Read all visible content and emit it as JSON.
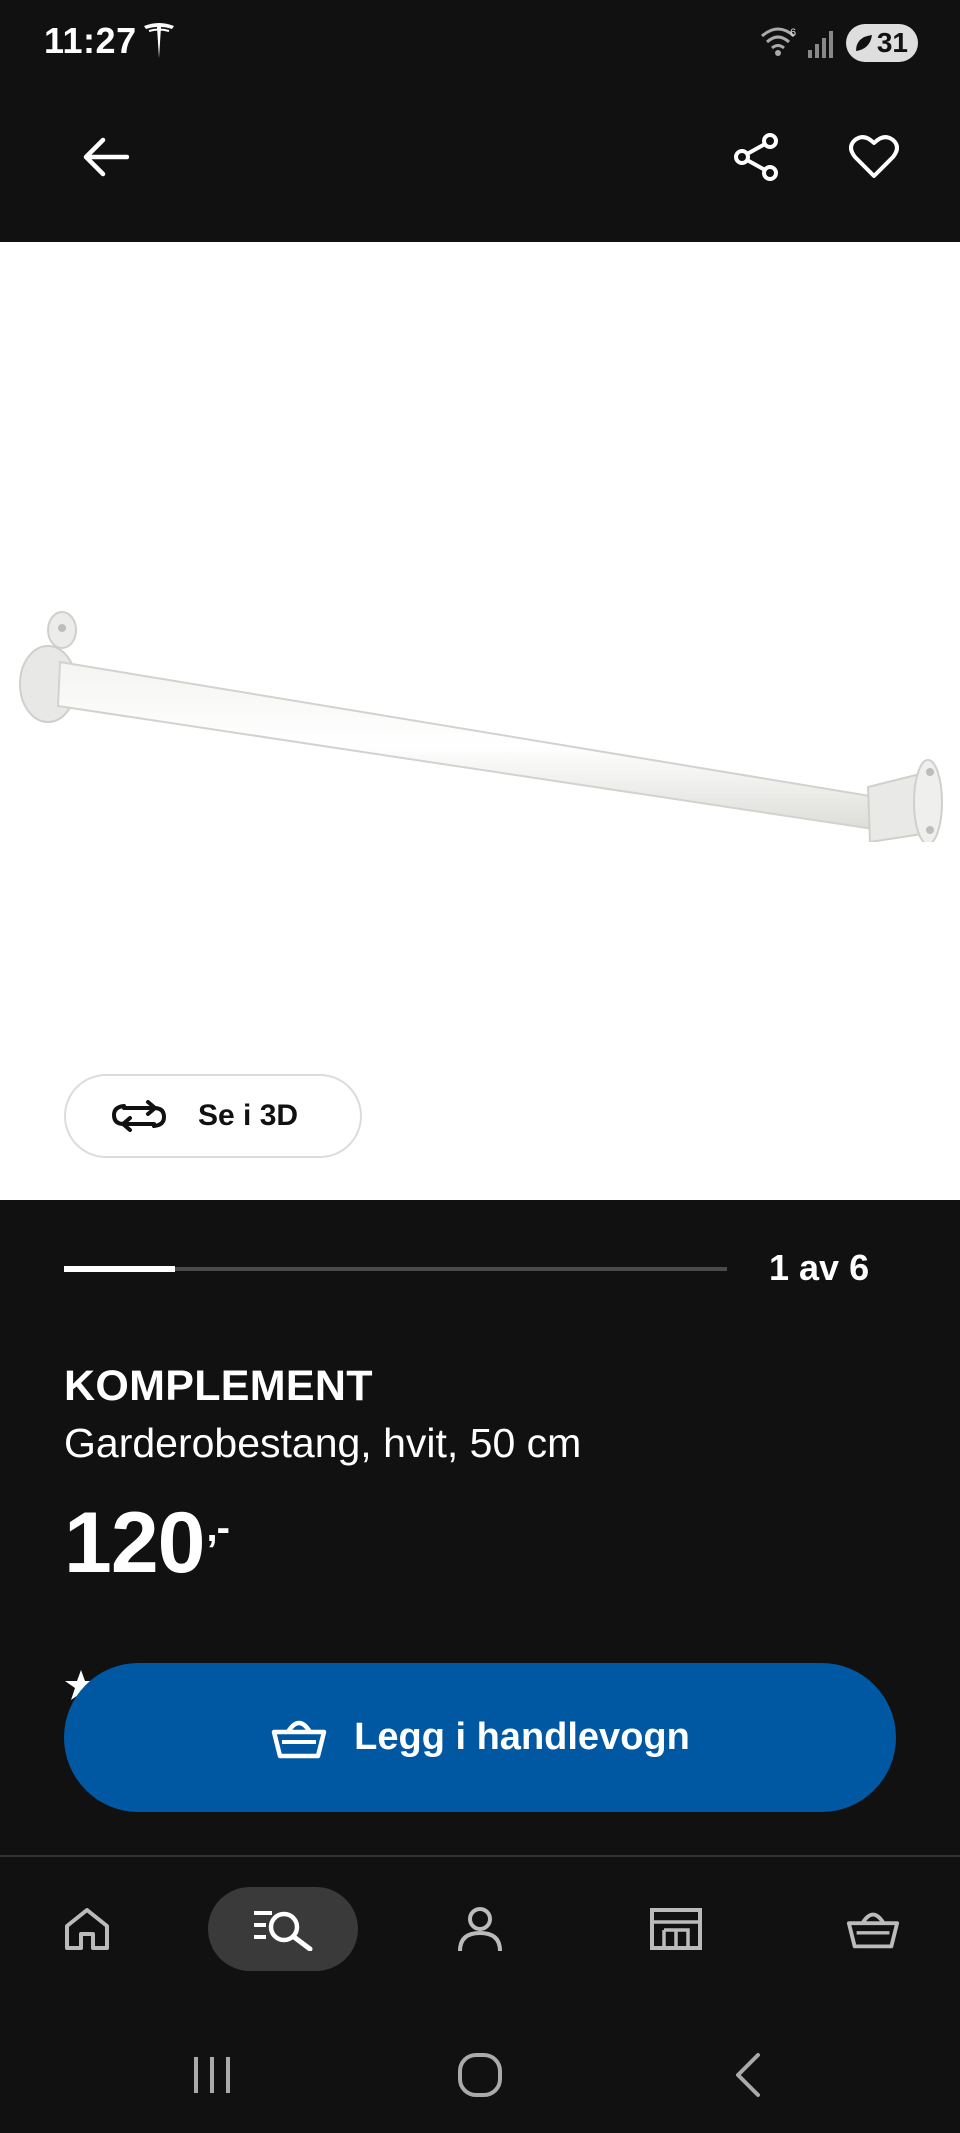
{
  "status_bar": {
    "time": "11:27",
    "battery": "31",
    "icons": [
      "tesla-icon",
      "wifi-icon",
      "signal-icon",
      "battery-icon"
    ]
  },
  "header": {
    "icons": [
      "back-arrow-icon",
      "share-icon",
      "heart-icon"
    ]
  },
  "gallery": {
    "view_3d_label": "Se i 3D",
    "counter": "1 av 6",
    "current_index": 1,
    "total": 6
  },
  "product": {
    "name": "KOMPLEMENT",
    "description": "Garderobestang, hvit, 50 cm",
    "price": "120",
    "price_suffix": ",-"
  },
  "cart": {
    "add_label": "Legg i handlevogn"
  },
  "bottom_nav": {
    "items": [
      {
        "name": "home",
        "icon": "home-icon",
        "active": false
      },
      {
        "name": "search",
        "icon": "search-list-icon",
        "active": true
      },
      {
        "name": "profile",
        "icon": "person-icon",
        "active": false
      },
      {
        "name": "store",
        "icon": "store-icon",
        "active": false
      },
      {
        "name": "cart",
        "icon": "basket-icon",
        "active": false
      }
    ]
  },
  "colors": {
    "background": "#111111",
    "primary_button": "#0058a3",
    "image_background": "#ffffff"
  }
}
